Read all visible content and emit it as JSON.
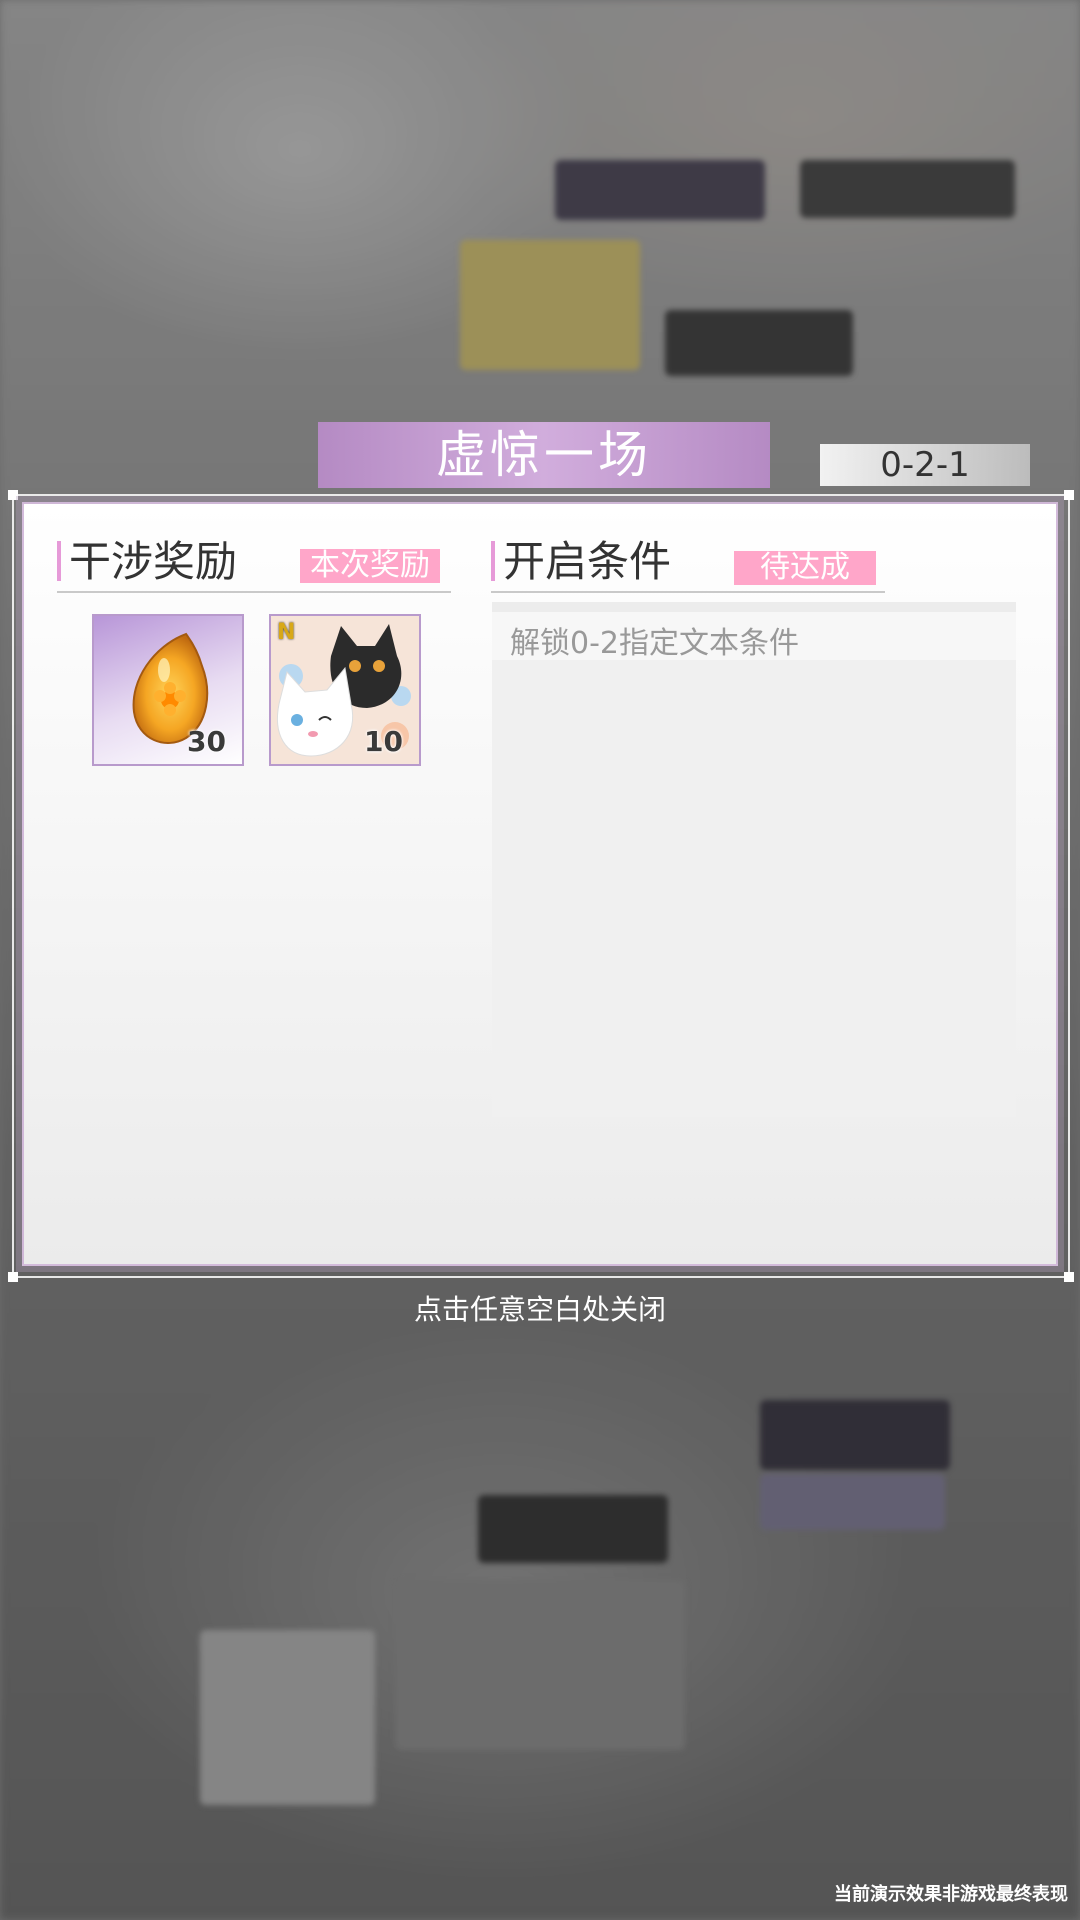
{
  "dialog": {
    "title": "虚惊一场",
    "stage_code": "0-2-1"
  },
  "rewards": {
    "heading": "干涉奖励",
    "tag": "本次奖励",
    "items": [
      {
        "icon": "amber-flower-gem-icon",
        "count": "30"
      },
      {
        "icon": "cat-card-icon",
        "rarity": "N",
        "count": "10"
      }
    ]
  },
  "conditions": {
    "heading": "开启条件",
    "tag": "待达成",
    "items": [
      {
        "text": "解锁0-2指定文本条件"
      }
    ]
  },
  "close_hint": "点击任意空白处关闭",
  "footer_note": "当前演示效果非游戏最终表现",
  "colors": {
    "accent_pink": "#ffa6c9",
    "title_purple": "#c89ad8",
    "section_bar": "#e69ad8"
  }
}
